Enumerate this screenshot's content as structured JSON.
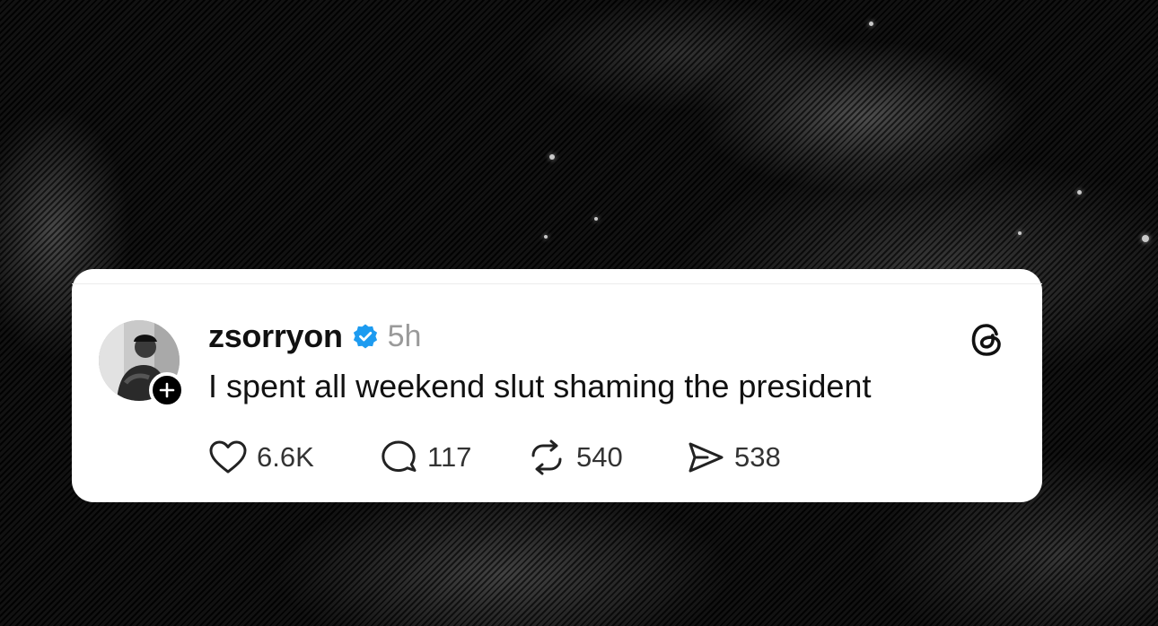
{
  "post": {
    "username": "zsorryon",
    "verified_icon": "verified-badge-icon",
    "time": "5h",
    "text": "I spent all weekend slut shaming the president",
    "app_logo_icon": "threads-logo-icon",
    "follow_icon": "plus-icon"
  },
  "actions": {
    "likes": "6.6K",
    "replies": "117",
    "reposts": "540",
    "shares": "538"
  },
  "colors": {
    "card": "#ffffff",
    "text": "#111111",
    "muted": "#9a9a9a",
    "verified": "#1d9bf0"
  }
}
